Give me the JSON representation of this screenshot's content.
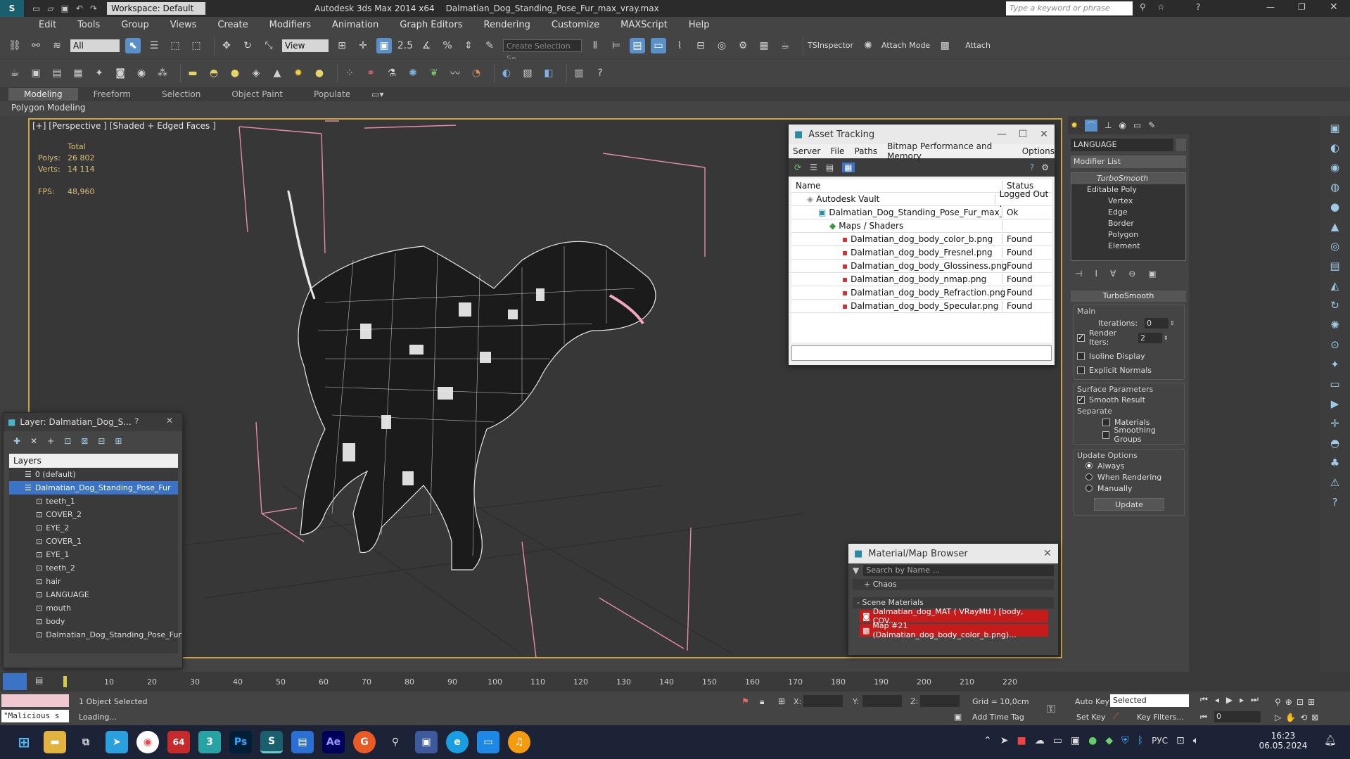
{
  "titlebar": {
    "workspace": "Workspace: Default",
    "app_title": "Autodesk 3ds Max 2014 x64",
    "file_title": "Dalmatian_Dog_Standing_Pose_Fur_max_vray.max",
    "search_placeholder": "Type a keyword or phrase"
  },
  "menu": [
    "Edit",
    "Tools",
    "Group",
    "Views",
    "Create",
    "Modifiers",
    "Animation",
    "Graph Editors",
    "Rendering",
    "Customize",
    "MAXScript",
    "Help"
  ],
  "toolbar": {
    "filter_value": "All",
    "refcoord_value": "View",
    "snap_value": "2.5",
    "selection_set_placeholder": "Create Selection Se",
    "tsinspector": "TSInspector",
    "attach_mode": "Attach Mode",
    "attach": "Attach"
  },
  "ribbon": {
    "tabs": [
      "Modeling",
      "Freeform",
      "Selection",
      "Object Paint",
      "Populate"
    ],
    "subtitle": "Polygon Modeling"
  },
  "viewport": {
    "label": "[+] [Perspective ] [Shaded + Edged Faces ]",
    "stats_header": "Total",
    "polys_label": "Polys:",
    "polys_value": "26 802",
    "verts_label": "Verts:",
    "verts_value": "14 114",
    "fps_label": "FPS:",
    "fps_value": "48,960"
  },
  "asset_tracking": {
    "title": "Asset Tracking",
    "menu": [
      "Server",
      "File",
      "Paths",
      "Bitmap Performance and Memory",
      "Options"
    ],
    "col_name": "Name",
    "col_status": "Status",
    "rows": [
      {
        "name": "Autodesk Vault",
        "status": "Logged Out ."
      },
      {
        "name": "Dalmatian_Dog_Standing_Pose_Fur_max_vr...",
        "status": "Ok"
      },
      {
        "name": "Maps / Shaders",
        "status": ""
      },
      {
        "name": "Dalmatian_dog_body_color_b.png",
        "status": "Found"
      },
      {
        "name": "Dalmatian_dog_body_Fresnel.png",
        "status": "Found"
      },
      {
        "name": "Dalmatian_dog_body_Glossiness.png",
        "status": "Found"
      },
      {
        "name": "Dalmatian_dog_body_nmap.png",
        "status": "Found"
      },
      {
        "name": "Dalmatian_dog_body_Refraction.png",
        "status": "Found"
      },
      {
        "name": "Dalmatian_dog_body_Specular.png",
        "status": "Found"
      }
    ]
  },
  "layer_window": {
    "title": "Layer: Dalmatian_Dog_S...",
    "header": "Layers",
    "items": [
      "0 (default)",
      "Dalmatian_Dog_Standing_Pose_Fur",
      "teeth_1",
      "COVER_2",
      "EYE_2",
      "COVER_1",
      "EYE_1",
      "teeth_2",
      "hair",
      "LANGUAGE",
      "mouth",
      "body",
      "Dalmatian_Dog_Standing_Pose_Fur"
    ]
  },
  "material_browser": {
    "title": "Material/Map Browser",
    "search_placeholder": "Search by Name ...",
    "group_chaos": "+ Chaos",
    "group_scene": "- Scene Materials",
    "items": [
      "Dalmatian_dog_MAT ( VRayMtl ) [body, COV...",
      "Map #21 (Dalmatian_dog_body_color_b.png)..."
    ]
  },
  "command_panel": {
    "object_name": "LANGUAGE",
    "modifier_list": "Modifier List",
    "stack": [
      "TurboSmooth",
      "Editable Poly",
      "Vertex",
      "Edge",
      "Border",
      "Polygon",
      "Element"
    ],
    "rollout_title": "TurboSmooth",
    "main_label": "Main",
    "iterations_label": "Iterations:",
    "iterations_value": "0",
    "render_iters_label": "Render Iters:",
    "render_iters_value": "2",
    "isoline": "Isoline Display",
    "explicit_normals": "Explicit Normals",
    "surface_params": "Surface Parameters",
    "smooth_result": "Smooth Result",
    "separate": "Separate",
    "materials": "Materials",
    "smoothing_groups": "Smoothing Groups",
    "update_options": "Update Options",
    "always": "Always",
    "when_rendering": "When Rendering",
    "manually": "Manually",
    "update_btn": "Update"
  },
  "timeline": {
    "ticks": [
      "10",
      "20",
      "30",
      "40",
      "50",
      "60",
      "70",
      "80",
      "90",
      "100",
      "110",
      "120",
      "130",
      "140",
      "150",
      "160",
      "170",
      "180",
      "190",
      "200",
      "210",
      "220"
    ]
  },
  "status": {
    "selected": "1 Object Selected",
    "loading": "Loading...",
    "script": "\"Malicious s",
    "x_label": "X:",
    "y_label": "Y:",
    "z_label": "Z:",
    "grid": "Grid = 10,0cm",
    "add_time_tag": "Add Time Tag",
    "auto_key": "Auto Key",
    "set_key": "Set Key",
    "selected_dd": "Selected",
    "key_filters": "Key Filters...",
    "frame": "0"
  },
  "taskbar": {
    "lang": "РУС",
    "time": "16:23",
    "date": "06.05.2024",
    "badge": "64"
  }
}
